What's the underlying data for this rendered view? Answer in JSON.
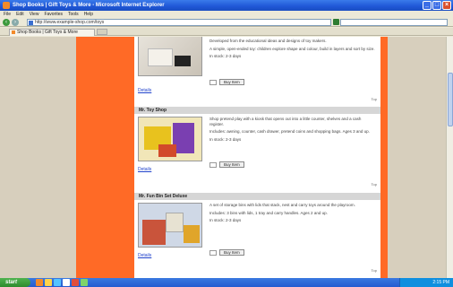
{
  "window": {
    "title": "Shop Books | Gift Toys & More - Microsoft Internet Explorer",
    "minimize": "_",
    "maximize": "□",
    "close": "×"
  },
  "menubar": [
    "File",
    "Edit",
    "View",
    "Favorites",
    "Tools",
    "Help"
  ],
  "address": {
    "url": "http://www.example-shop.com/toys"
  },
  "tab": {
    "label": "Shop Books | Gift Toys & More"
  },
  "products": [
    {
      "name": "",
      "desc": [
        "Developed from the educational ideas and designs of toy makers.",
        "A simple, open-ended toy: children explore shape and colour, build in layers and sort by size.",
        "In stock: 2-3 days"
      ],
      "details": "Details",
      "buy": "Buy Item",
      "top": "Top"
    },
    {
      "name": "Mr. Toy Shop",
      "desc": [
        "Shop pretend play with a kiosk that opens out into a little counter, shelves and a cash register.",
        "Includes: awning, counter, cash drawer, pretend coins and shopping bags. Ages 3 and up.",
        "In stock: 2-3 days"
      ],
      "details": "Details",
      "buy": "Buy Item",
      "top": "Top"
    },
    {
      "name": "Mr. Fun Bin Set Deluxe",
      "desc": [
        "A set of storage bins with lids that stack, nest and carry toys around the playroom.",
        "Includes: 3 bins with lids, 1 tray and carry handles. Ages 2 and up.",
        "In stock: 2-3 days"
      ],
      "details": "Details",
      "buy": "Buy Item",
      "top": "Top"
    }
  ],
  "taskbar": {
    "start": "start",
    "clock": "2:15 PM"
  }
}
